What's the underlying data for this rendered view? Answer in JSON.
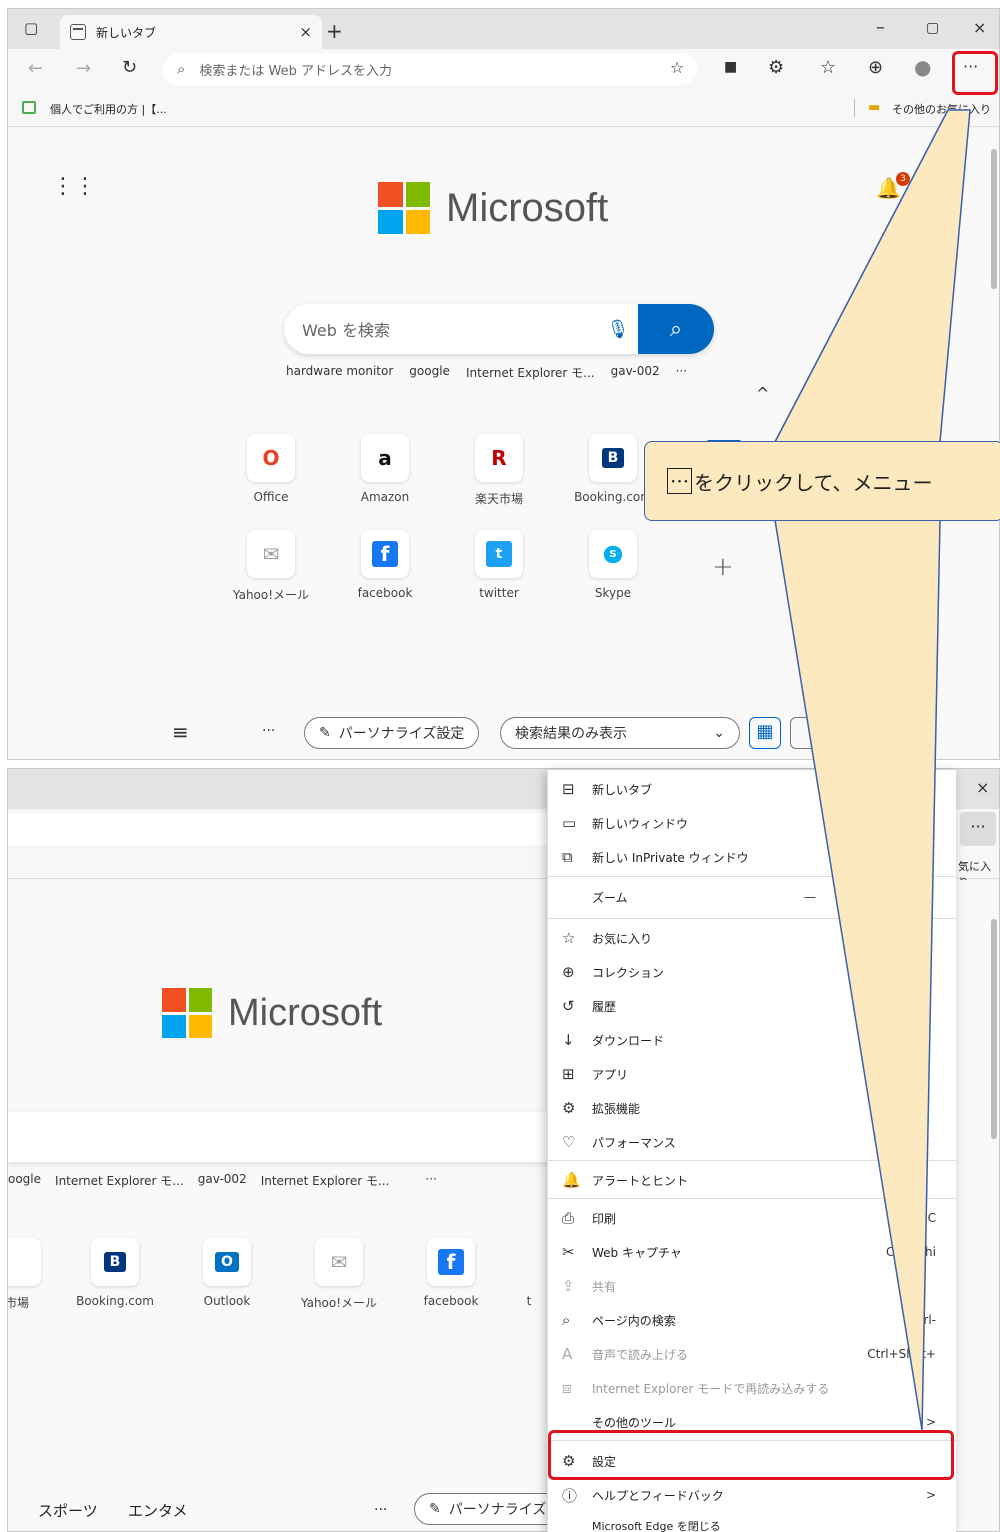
{
  "browser": {
    "tab_title": "新しいタブ",
    "address_placeholder": "検索または Web アドレスを入力",
    "more_label": "···",
    "favorites_item": "個人でご利用の方 |【...",
    "other_favorites": "その他のお気に入り",
    "other_favorites_short": "気に入り"
  },
  "newtab": {
    "brand": "Microsoft",
    "search_placeholder": "Web を検索",
    "notification_count": "3",
    "suggestions": [
      "hardware monitor",
      "google",
      "Internet Explorer モ...",
      "gav-002",
      "···"
    ],
    "tiles": [
      {
        "label": "Office",
        "glyph": "O",
        "color": "#e74025"
      },
      {
        "label": "Amazon",
        "glyph": "a",
        "color": "#111111"
      },
      {
        "label": "楽天市場",
        "glyph": "R",
        "color": "#bf0000"
      },
      {
        "label": "Booking.com",
        "glyph": "B",
        "color": "#ffffff"
      }
    ],
    "tiles_row2": [
      {
        "label": "Yahoo!メール",
        "glyph": "✉",
        "color": "#a0a0a0"
      },
      {
        "label": "facebook",
        "glyph": "f",
        "color": "#ffffff"
      },
      {
        "label": "twitter",
        "glyph": "t",
        "color": "#ffffff"
      },
      {
        "label": "Skype",
        "glyph": "S",
        "color": "#ffffff"
      }
    ],
    "personalize_label": "パーソナライズ設定",
    "display_mode": "検索結果のみ表示",
    "nav_more": "···"
  },
  "page2": {
    "suggestions": [
      "oogle",
      "Internet Explorer モ...",
      "gav-002",
      "Internet Explorer モ...",
      "···"
    ],
    "tiles": [
      {
        "label": "市場",
        "glyph": ""
      },
      {
        "label": "Booking.com",
        "glyph": "B"
      },
      {
        "label": "Outlook",
        "glyph": "O"
      },
      {
        "label": "Yahoo!メール",
        "glyph": "✉"
      },
      {
        "label": "facebook",
        "glyph": "f"
      },
      {
        "label": "t",
        "glyph": ""
      }
    ],
    "nav": [
      "スポーツ",
      "エンタメ"
    ],
    "nav_more": "···",
    "personalize_label": "パーソナライズ"
  },
  "menu": {
    "items": [
      {
        "label": "新しいタブ",
        "shortcut": ""
      },
      {
        "label": "新しいウィンドウ",
        "shortcut": ""
      },
      {
        "label": "新しい InPrivate ウィンドウ",
        "shortcut": ""
      },
      {
        "label": "ズーム",
        "shortcut": "—"
      },
      {
        "label": "お気に入り",
        "shortcut": ""
      },
      {
        "label": "コレクション",
        "shortcut": ""
      },
      {
        "label": "履歴",
        "shortcut": ""
      },
      {
        "label": "ダウンロード",
        "shortcut": ""
      },
      {
        "label": "アプリ",
        "shortcut": ""
      },
      {
        "label": "拡張機能",
        "shortcut": ""
      },
      {
        "label": "パフォーマンス",
        "shortcut": ""
      },
      {
        "label": "アラートとヒント",
        "shortcut": ""
      },
      {
        "label": "印刷",
        "shortcut": "C"
      },
      {
        "label": "Web キャプチャ",
        "shortcut": "Ctrl+Shi"
      },
      {
        "label": "共有",
        "shortcut": ""
      },
      {
        "label": "ページ内の検索",
        "shortcut": "Ctrl-"
      },
      {
        "label": "音声で読み上げる",
        "shortcut": "Ctrl+Shift+"
      },
      {
        "label": "Internet Explorer モードで再読み込みする",
        "shortcut": ""
      },
      {
        "label": "その他のツール",
        "shortcut": ">"
      },
      {
        "label": "設定",
        "shortcut": ""
      },
      {
        "label": "ヘルプとフィードバック",
        "shortcut": ">"
      },
      {
        "label": "Microsoft Edge を閉じる",
        "shortcut": ""
      }
    ]
  },
  "callout": {
    "dots": "···",
    "text": "をクリックして、メニュー"
  },
  "colors": {
    "highlight": "#e0131e",
    "callout_fill": "#fde9bf",
    "callout_border": "#3a5fae",
    "edge_blue": "#0067c0"
  }
}
